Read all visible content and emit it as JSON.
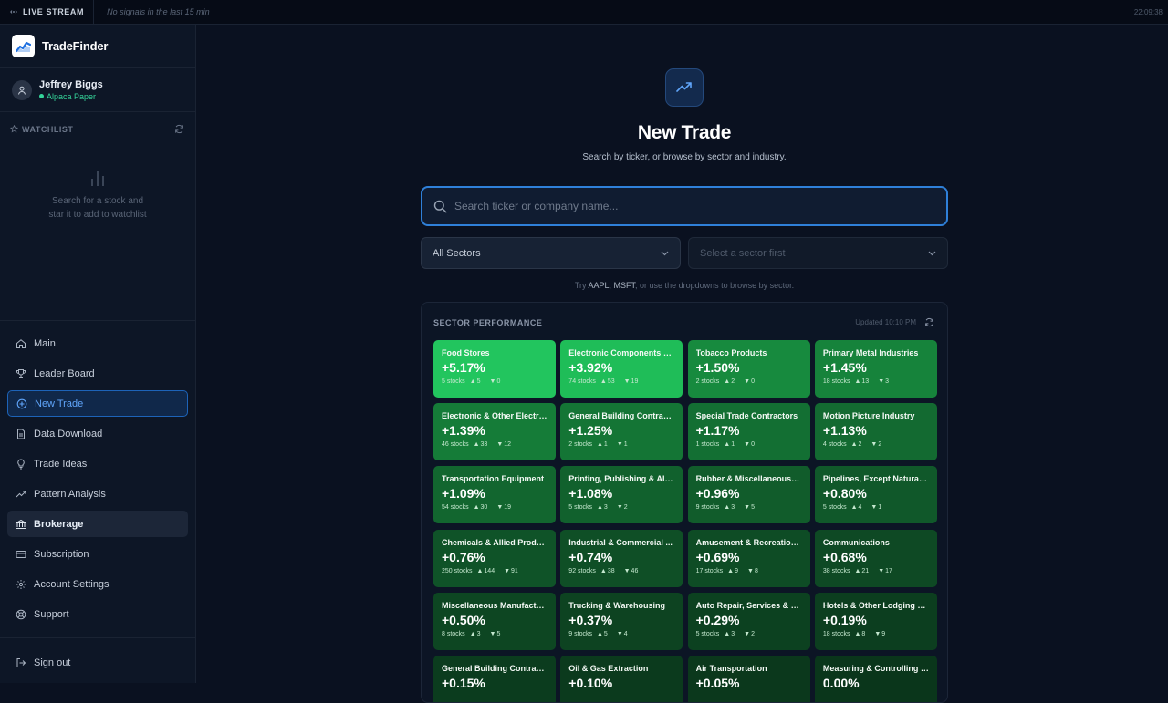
{
  "topbar": {
    "live": "LIVE STREAM",
    "status": "No signals in the last 15 min",
    "time": "22:09:38"
  },
  "brand": {
    "name": "TradeFinder"
  },
  "user": {
    "name": "Jeffrey Biggs",
    "account": "Alpaca Paper"
  },
  "watchlist": {
    "title": "WATCHLIST",
    "empty_line1": "Search for a stock and",
    "empty_line2": "star it to add to watchlist"
  },
  "nav": [
    {
      "label": "Main",
      "icon": "home-icon"
    },
    {
      "label": "Leader Board",
      "icon": "trophy-icon"
    },
    {
      "label": "New Trade",
      "icon": "plus-circle-icon"
    },
    {
      "label": "Data Download",
      "icon": "file-icon"
    },
    {
      "label": "Trade Ideas",
      "icon": "lightbulb-icon"
    },
    {
      "label": "Pattern Analysis",
      "icon": "trend-icon"
    },
    {
      "label": "Brokerage",
      "icon": "bank-icon"
    },
    {
      "label": "Subscription",
      "icon": "card-icon"
    },
    {
      "label": "Account Settings",
      "icon": "gear-icon"
    },
    {
      "label": "Support",
      "icon": "lifebuoy-icon"
    }
  ],
  "signout": "Sign out",
  "hero": {
    "title": "New Trade",
    "subtitle": "Search by ticker, or browse by sector and industry."
  },
  "search": {
    "placeholder": "Search ticker or company name..."
  },
  "sector_select": {
    "value": "All Sectors"
  },
  "industry_select": {
    "value": "Select a sector first"
  },
  "hint": {
    "pre": "Try ",
    "t1": "AAPL",
    "sep": ", ",
    "t2": "MSFT",
    "post": ", or use the dropdowns to browse by sector."
  },
  "panel": {
    "title": "SECTOR PERFORMANCE",
    "updated": "Updated 10:10 PM"
  },
  "colors": {
    "accent": "#2f80d9",
    "up_strong": "#22c55e",
    "up_dark": "#0b4a22"
  },
  "sectors": [
    {
      "name": "Food Stores",
      "change": "+5.17%",
      "stocks": "5 stocks",
      "up": "5",
      "down": "0"
    },
    {
      "name": "Electronic Components & ...",
      "change": "+3.92%",
      "stocks": "74 stocks",
      "up": "53",
      "down": "19"
    },
    {
      "name": "Tobacco Products",
      "change": "+1.50%",
      "stocks": "2 stocks",
      "up": "2",
      "down": "0"
    },
    {
      "name": "Primary Metal Industries",
      "change": "+1.45%",
      "stocks": "18 stocks",
      "up": "13",
      "down": "3"
    },
    {
      "name": "Electronic & Other Electric...",
      "change": "+1.39%",
      "stocks": "46 stocks",
      "up": "33",
      "down": "12"
    },
    {
      "name": "General Building Contract...",
      "change": "+1.25%",
      "stocks": "2 stocks",
      "up": "1",
      "down": "1"
    },
    {
      "name": "Special Trade Contractors",
      "change": "+1.17%",
      "stocks": "1 stocks",
      "up": "1",
      "down": "0"
    },
    {
      "name": "Motion Picture Industry",
      "change": "+1.13%",
      "stocks": "4 stocks",
      "up": "2",
      "down": "2"
    },
    {
      "name": "Transportation Equipment",
      "change": "+1.09%",
      "stocks": "54 stocks",
      "up": "30",
      "down": "19"
    },
    {
      "name": "Printing, Publishing & Alli...",
      "change": "+1.08%",
      "stocks": "5 stocks",
      "up": "3",
      "down": "2"
    },
    {
      "name": "Rubber & Miscellaneous P...",
      "change": "+0.96%",
      "stocks": "9 stocks",
      "up": "3",
      "down": "5"
    },
    {
      "name": "Pipelines, Except Natural ...",
      "change": "+0.80%",
      "stocks": "5 stocks",
      "up": "4",
      "down": "1"
    },
    {
      "name": "Chemicals & Allied Products",
      "change": "+0.76%",
      "stocks": "250 stocks",
      "up": "144",
      "down": "91"
    },
    {
      "name": "Industrial & Commercial ...",
      "change": "+0.74%",
      "stocks": "92 stocks",
      "up": "38",
      "down": "46"
    },
    {
      "name": "Amusement & Recreation ...",
      "change": "+0.69%",
      "stocks": "17 stocks",
      "up": "9",
      "down": "8"
    },
    {
      "name": "Communications",
      "change": "+0.68%",
      "stocks": "38 stocks",
      "up": "21",
      "down": "17"
    },
    {
      "name": "Miscellaneous Manufactur...",
      "change": "+0.50%",
      "stocks": "8 stocks",
      "up": "3",
      "down": "5"
    },
    {
      "name": "Trucking & Warehousing",
      "change": "+0.37%",
      "stocks": "9 stocks",
      "up": "5",
      "down": "4"
    },
    {
      "name": "Auto Repair, Services & Pa...",
      "change": "+0.29%",
      "stocks": "5 stocks",
      "up": "3",
      "down": "2"
    },
    {
      "name": "Hotels & Other Lodging Pl...",
      "change": "+0.19%",
      "stocks": "18 stocks",
      "up": "8",
      "down": "9"
    },
    {
      "name": "General Building Contract...",
      "change": "+0.15%",
      "stocks": "",
      "up": "",
      "down": ""
    },
    {
      "name": "Oil & Gas Extraction",
      "change": "+0.10%",
      "stocks": "",
      "up": "",
      "down": ""
    },
    {
      "name": "Air Transportation",
      "change": "+0.05%",
      "stocks": "",
      "up": "",
      "down": ""
    },
    {
      "name": "Measuring & Controlling I...",
      "change": "0.00%",
      "stocks": "",
      "up": "",
      "down": ""
    }
  ]
}
